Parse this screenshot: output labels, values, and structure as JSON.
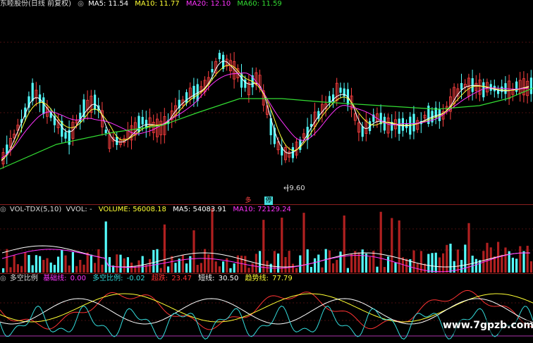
{
  "header_main": {
    "stock": "东睦股份(日线 前复权)",
    "ma5": "MA5: 11.54",
    "ma10": "MA10: 11.77",
    "ma20": "MA20: 12.10",
    "ma60": "MA60: 11.59",
    "colors": {
      "ma5": "#ffffff",
      "ma10": "#ffff33",
      "ma20": "#ff33ff",
      "ma60": "#33dd33"
    }
  },
  "header_vol": {
    "name": "VOL-TDX(5,10)",
    "vvol": "VVOL: -",
    "volume": "VOLUME: 56008.18",
    "ma5": "MA5: 54083.91",
    "ma10": "MA10: 72129.24"
  },
  "header_ind": {
    "name": "多空比例",
    "base_label": "基础线:",
    "base_value": "0.00",
    "ratio_label": "多空比例:",
    "ratio_value": "-0.02",
    "overbuy_label": "超跌:",
    "overbuy_value": "23.47",
    "short_label": "短线:",
    "short_value": "30.50",
    "trend_label": "趋势线:",
    "trend_value": "77.79"
  },
  "annotations": {
    "low_price": "9.60",
    "flag_a": "多",
    "flag_b": "停"
  },
  "watermark": "www.7gpzb.com",
  "chart_data": [
    {
      "type": "candlestick",
      "title": "东睦股份(日线 前复权)",
      "series": [
        {
          "name": "MA5",
          "color": "#ffffff"
        },
        {
          "name": "MA10",
          "color": "#ffff33"
        },
        {
          "name": "MA20",
          "color": "#ff33ff"
        },
        {
          "name": "MA60",
          "color": "#33dd33"
        }
      ],
      "last_values": {
        "MA5": 11.54,
        "MA10": 11.77,
        "MA20": 12.1,
        "MA60": 11.59
      },
      "annotated_low": 9.6
    },
    {
      "type": "bar",
      "title": "VOL-TDX(5,10)",
      "last_values": {
        "VOLUME": 56008.18,
        "MA5": 54083.91,
        "MA10": 72129.24
      }
    },
    {
      "type": "line",
      "title": "多空比例",
      "last_values": {
        "基础线": 0.0,
        "多空比例": -0.02,
        "超跌": 23.47,
        "短线": 30.5,
        "趋势线": 77.79
      }
    }
  ]
}
